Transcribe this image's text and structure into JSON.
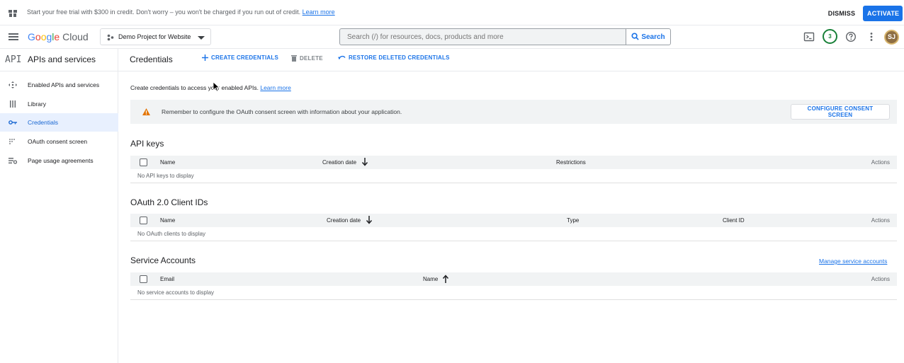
{
  "banner": {
    "message": "Start your free trial with $300 in credit. Don't worry – you won't be charged if you run out of credit.",
    "learn_more": "Learn more",
    "dismiss": "DISMISS",
    "activate": "ACTIVATE"
  },
  "header": {
    "logo_google": [
      "G",
      "o",
      "o",
      "g",
      "l",
      "e"
    ],
    "logo_cloud": "Cloud",
    "project": "Demo Project for Website",
    "search_placeholder": "Search (/) for resources, docs, products and more",
    "search_button": "Search",
    "notification_count": "3",
    "avatar_initials": "SJ"
  },
  "sidebar": {
    "section_icon": "API",
    "title": "APIs and services",
    "items": [
      {
        "label": "Enabled APIs and services",
        "icon": "diamond-arrows-icon"
      },
      {
        "label": "Library",
        "icon": "library-icon"
      },
      {
        "label": "Credentials",
        "icon": "key-icon",
        "active": true
      },
      {
        "label": "OAuth consent screen",
        "icon": "consent-icon"
      },
      {
        "label": "Page usage agreements",
        "icon": "settings-list-icon"
      }
    ]
  },
  "toolbar": {
    "page_title": "Credentials",
    "create": "CREATE CREDENTIALS",
    "delete": "DELETE",
    "restore": "RESTORE DELETED CREDENTIALS"
  },
  "content": {
    "intro": "Create credentials to access your enabled APIs.",
    "intro_link": "Learn more",
    "notice": "Remember to configure the OAuth consent screen with information about your application.",
    "configure_button": "CONFIGURE CONSENT SCREEN",
    "api_keys": {
      "title": "API keys",
      "columns": [
        "Name",
        "Creation date",
        "Restrictions",
        "Actions"
      ],
      "empty": "No API keys to display"
    },
    "oauth": {
      "title": "OAuth 2.0 Client IDs",
      "columns": [
        "Name",
        "Creation date",
        "Type",
        "Client ID",
        "Actions"
      ],
      "empty": "No OAuth clients to display"
    },
    "service_accounts": {
      "title": "Service Accounts",
      "manage_link": "Manage service accounts",
      "columns": [
        "Email",
        "Name",
        "Actions"
      ],
      "empty": "No service accounts to display"
    }
  },
  "colors": {
    "primary": "#1a73e8",
    "active_nav_bg": "#e8f0fe",
    "warning": "#e37400"
  }
}
